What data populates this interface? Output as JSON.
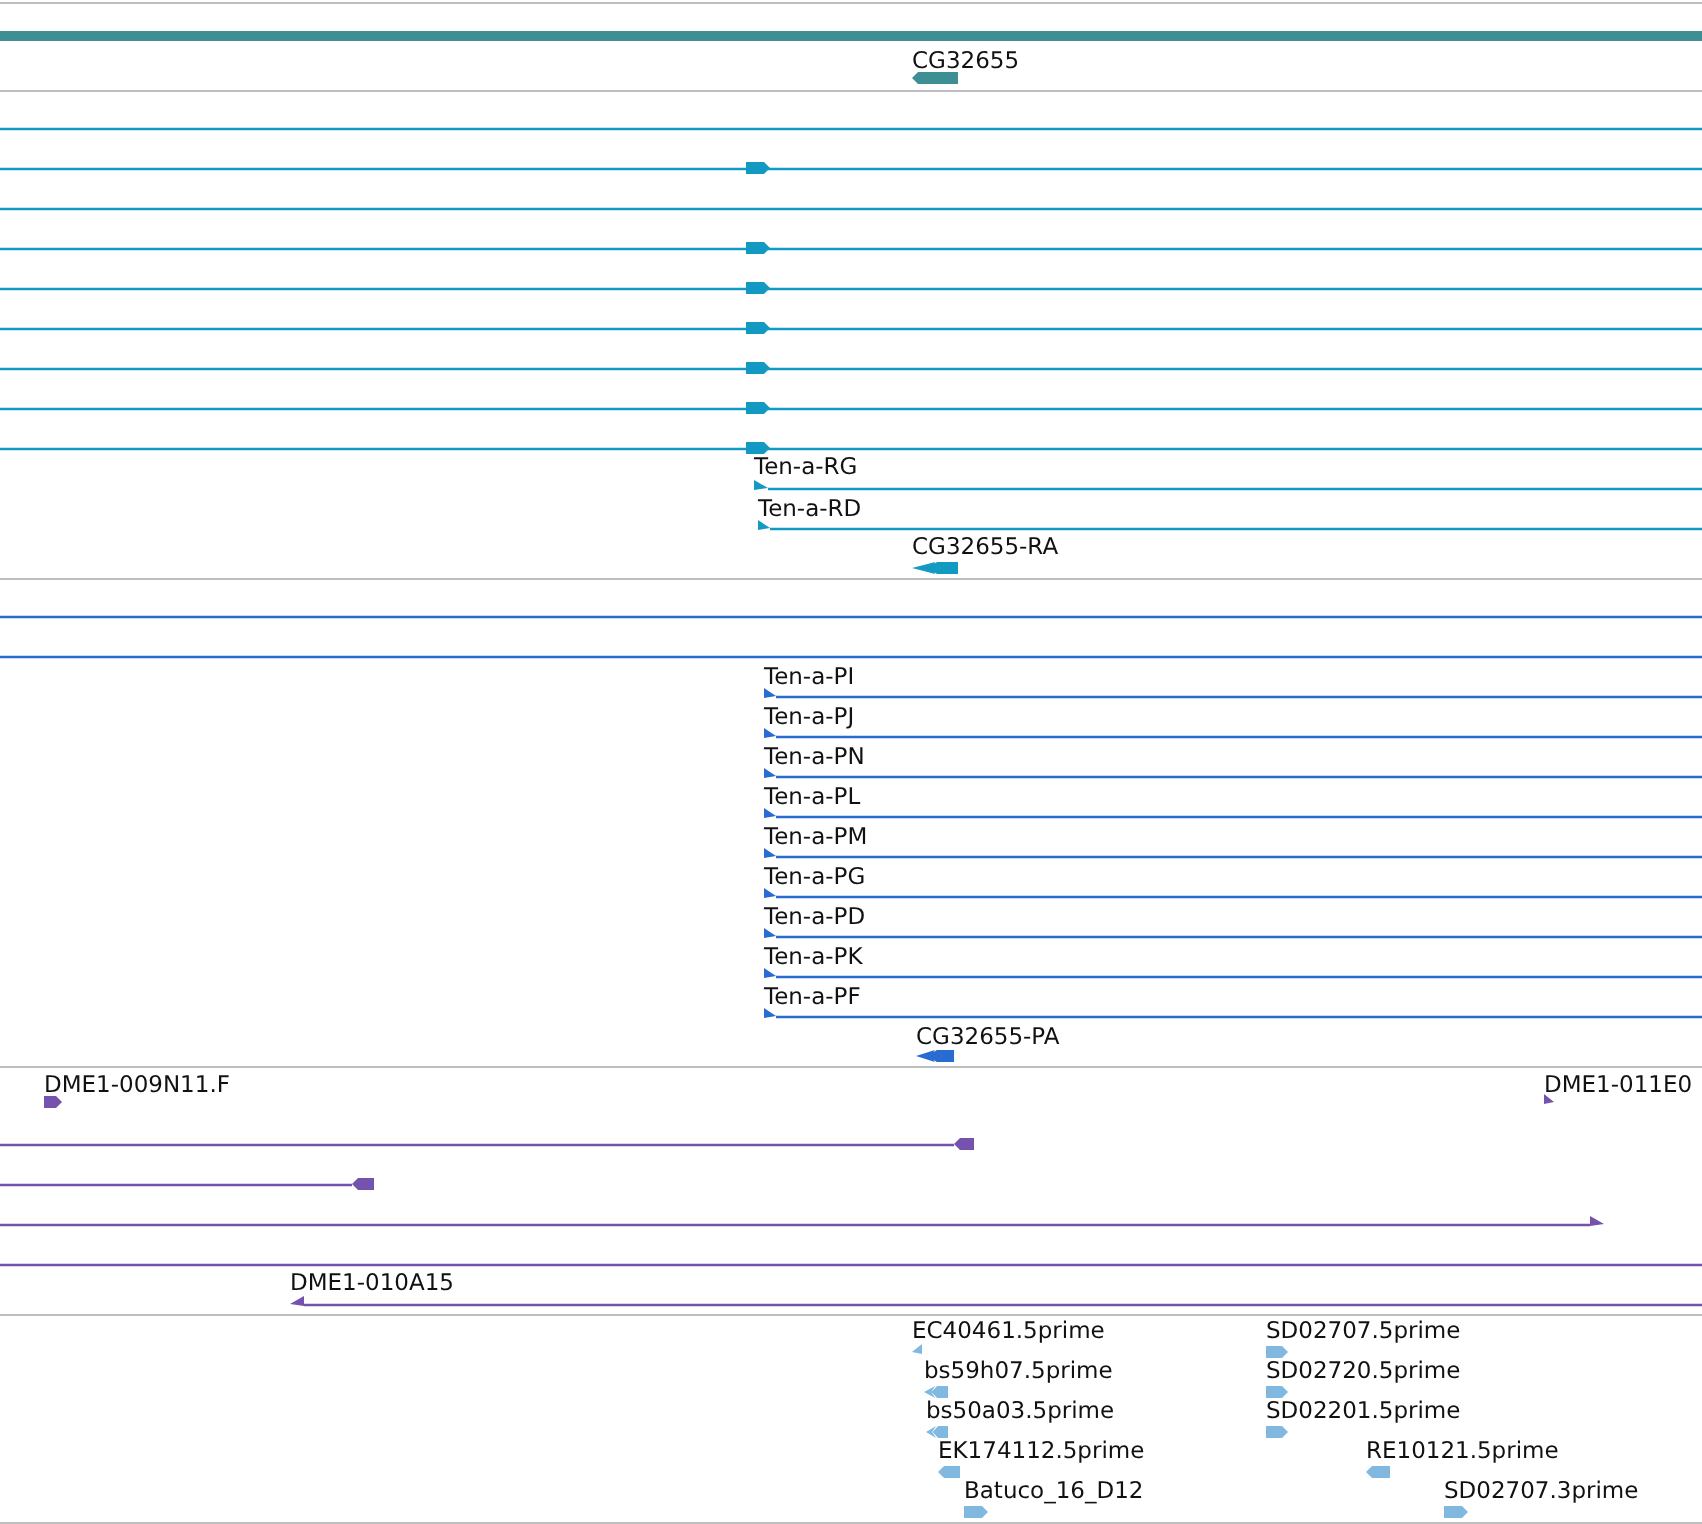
{
  "tracks": [
    {
      "color": "#3d8f94",
      "features": [
        {
          "kind": "bar"
        },
        {
          "kind": "transcript",
          "label": "CG32655",
          "reverse": true
        }
      ]
    },
    {
      "color": "#139ac3",
      "features": [
        {
          "kind": "line"
        },
        {
          "kind": "transcript",
          "reverse": false
        },
        {
          "kind": "line"
        },
        {
          "kind": "transcript",
          "reverse": false
        },
        {
          "kind": "transcript",
          "reverse": false
        },
        {
          "kind": "transcript",
          "reverse": false
        },
        {
          "kind": "transcript",
          "reverse": false
        },
        {
          "kind": "transcript",
          "reverse": false
        },
        {
          "kind": "transcript",
          "reverse": false
        },
        {
          "kind": "transcript",
          "label": "Ten-a-RG",
          "reverse": false
        },
        {
          "kind": "transcript",
          "label": "Ten-a-RD",
          "reverse": false
        },
        {
          "kind": "transcript",
          "label": "CG32655-RA",
          "reverse": true
        }
      ]
    },
    {
      "color": "#2a6bd1",
      "features": [
        {
          "kind": "line"
        },
        {
          "kind": "line"
        },
        {
          "kind": "transcript",
          "label": "Ten-a-PI",
          "reverse": false
        },
        {
          "kind": "transcript",
          "label": "Ten-a-PJ",
          "reverse": false
        },
        {
          "kind": "transcript",
          "label": "Ten-a-PN",
          "reverse": false
        },
        {
          "kind": "transcript",
          "label": "Ten-a-PL",
          "reverse": false
        },
        {
          "kind": "transcript",
          "label": "Ten-a-PM",
          "reverse": false
        },
        {
          "kind": "transcript",
          "label": "Ten-a-PG",
          "reverse": false
        },
        {
          "kind": "transcript",
          "label": "Ten-a-PD",
          "reverse": false
        },
        {
          "kind": "transcript",
          "label": "Ten-a-PK",
          "reverse": false
        },
        {
          "kind": "transcript",
          "label": "Ten-a-PF",
          "reverse": false
        },
        {
          "kind": "transcript",
          "label": "CG32655-PA",
          "reverse": true
        }
      ]
    },
    {
      "color": "#7452ad",
      "features": [
        {
          "kind": "transcript",
          "label": "DME1-009N11.F",
          "reverse": false
        },
        {
          "kind": "transcript",
          "label": "DME1-011E0",
          "reverse": false
        },
        {
          "kind": "transcript",
          "reverse": true
        },
        {
          "kind": "transcript",
          "reverse": true
        },
        {
          "kind": "transcript",
          "reverse": false
        },
        {
          "kind": "line"
        },
        {
          "kind": "transcript",
          "label": "DME1-010A15",
          "reverse": true
        }
      ]
    },
    {
      "color": "#80b8e0",
      "features": [
        {
          "kind": "transcript",
          "label": "EC40461.5prime",
          "reverse": true
        },
        {
          "kind": "transcript",
          "label": "bs59h07.5prime",
          "reverse": true
        },
        {
          "kind": "transcript",
          "label": "bs50a03.5prime",
          "reverse": true
        },
        {
          "kind": "transcript",
          "label": "EK174112.5prime",
          "reverse": true
        },
        {
          "kind": "transcript",
          "label": "Batuco_16_D12",
          "reverse": false
        },
        {
          "kind": "transcript",
          "label": "SD02707.5prime",
          "reverse": false
        },
        {
          "kind": "transcript",
          "label": "SD02720.5prime",
          "reverse": false
        },
        {
          "kind": "transcript",
          "label": "SD02201.5prime",
          "reverse": false
        },
        {
          "kind": "transcript",
          "label": "RE10121.5prime",
          "reverse": true
        },
        {
          "kind": "transcript",
          "label": "SD02707.3prime",
          "reverse": false
        }
      ]
    }
  ]
}
